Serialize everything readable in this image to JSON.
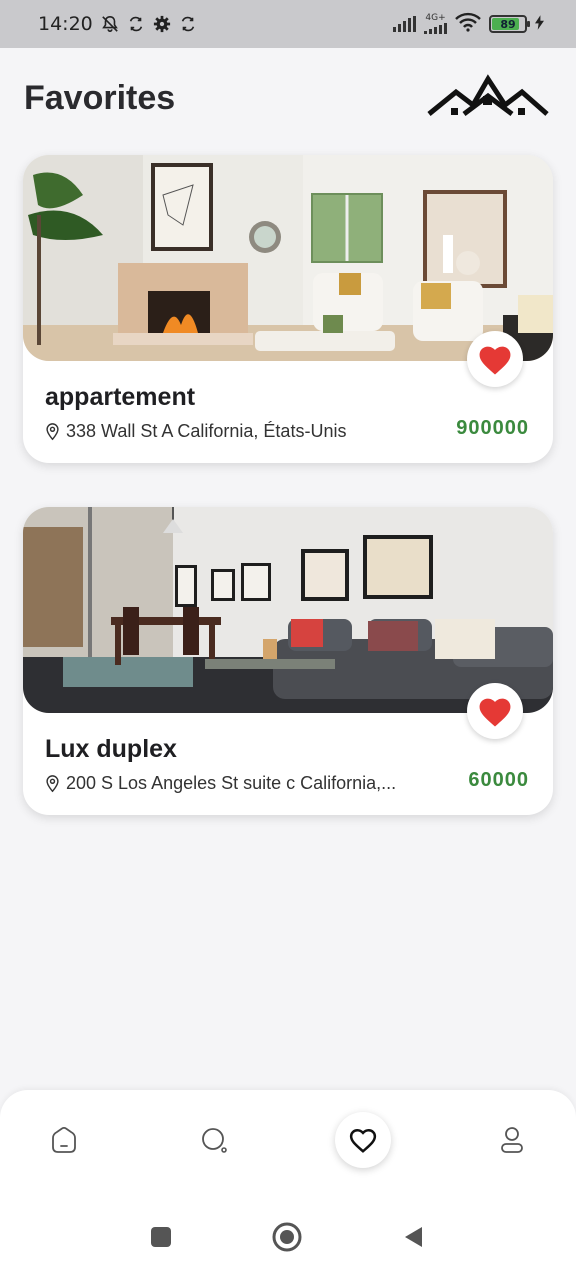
{
  "status_bar": {
    "time": "14:20",
    "network_label": "4G+",
    "battery_level": "89",
    "icons": [
      "bell-off-icon",
      "sync-icon",
      "gear-icon",
      "sync-icon",
      "signal-icon",
      "signal-4g-icon",
      "wifi-icon",
      "battery-icon",
      "charging-icon"
    ]
  },
  "header": {
    "title": "Favorites",
    "logo_icon": "houses-logo-icon"
  },
  "favorites": [
    {
      "title": "appartement",
      "address": "338 Wall St A California, États-Unis",
      "price": "900000",
      "favorite_icon": "heart-filled-icon"
    },
    {
      "title": "Lux duplex",
      "address": "200 S Los Angeles St suite c California,...",
      "price": "60000",
      "favorite_icon": "heart-filled-icon"
    }
  ],
  "bottom_nav": {
    "items": [
      {
        "icon": "home-icon",
        "active": false
      },
      {
        "icon": "search-icon",
        "active": false
      },
      {
        "icon": "heart-icon",
        "active": true
      },
      {
        "icon": "profile-icon",
        "active": false
      }
    ]
  },
  "system_nav": {
    "items": [
      "recents-square-icon",
      "home-circle-icon",
      "back-triangle-icon"
    ]
  },
  "colors": {
    "price": "#3b8a3e",
    "heart": "#e53935",
    "background": "#f5f5f7"
  }
}
